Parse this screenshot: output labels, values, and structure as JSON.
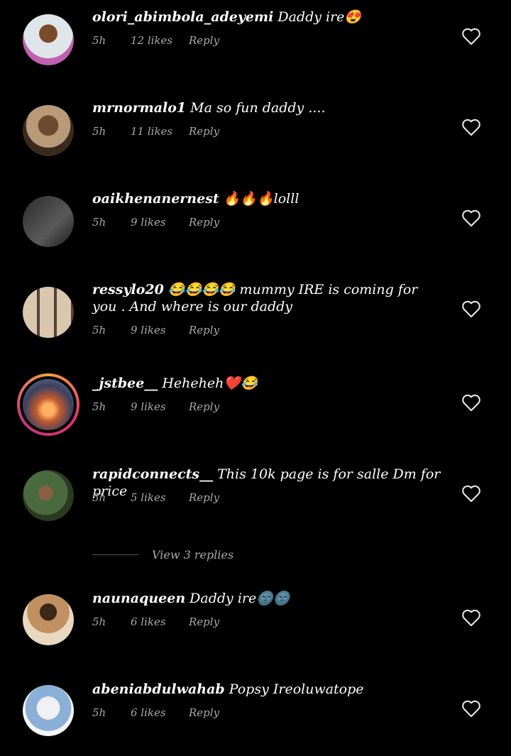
{
  "comments": [
    {
      "username": "olori_abimbola_adeyemi",
      "text": "Daddy ire😍",
      "time": "5h",
      "likes": "12 likes",
      "reply": "Reply"
    },
    {
      "username": "mrnormalo1",
      "text": "Ma so fun daddy ....",
      "time": "5h",
      "likes": "11 likes",
      "reply": "Reply"
    },
    {
      "username": "oaikhenanernest",
      "text": "🔥🔥🔥lolll",
      "time": "5h",
      "likes": "9 likes",
      "reply": "Reply"
    },
    {
      "username": "ressylo20",
      "text": "😂😂😂😂 mummy IRE is coming for you . And where is our daddy",
      "time": "5h",
      "likes": "9 likes",
      "reply": "Reply"
    },
    {
      "username": "_jstbee__",
      "text": "Heheheh❤️😂",
      "time": "5h",
      "likes": "9 likes",
      "reply": "Reply"
    },
    {
      "username": "rapidconnects__",
      "text": "This 10k page is for salle Dm for price",
      "time": "5h",
      "likes": "5 likes",
      "reply": "Reply"
    },
    {
      "username": "naunaqueen",
      "text": "Daddy ire🌚🌚",
      "time": "5h",
      "likes": "6 likes",
      "reply": "Reply"
    },
    {
      "username": "abeniabdulwahab",
      "text": "Popsy Ireoluwatope",
      "time": "5h",
      "likes": "6 likes",
      "reply": "Reply"
    }
  ],
  "view_replies": "View 3 replies",
  "icons": {
    "like": "heart-outline-icon"
  },
  "colors": {
    "background": "#000000",
    "meta": "#a8a8a8"
  }
}
